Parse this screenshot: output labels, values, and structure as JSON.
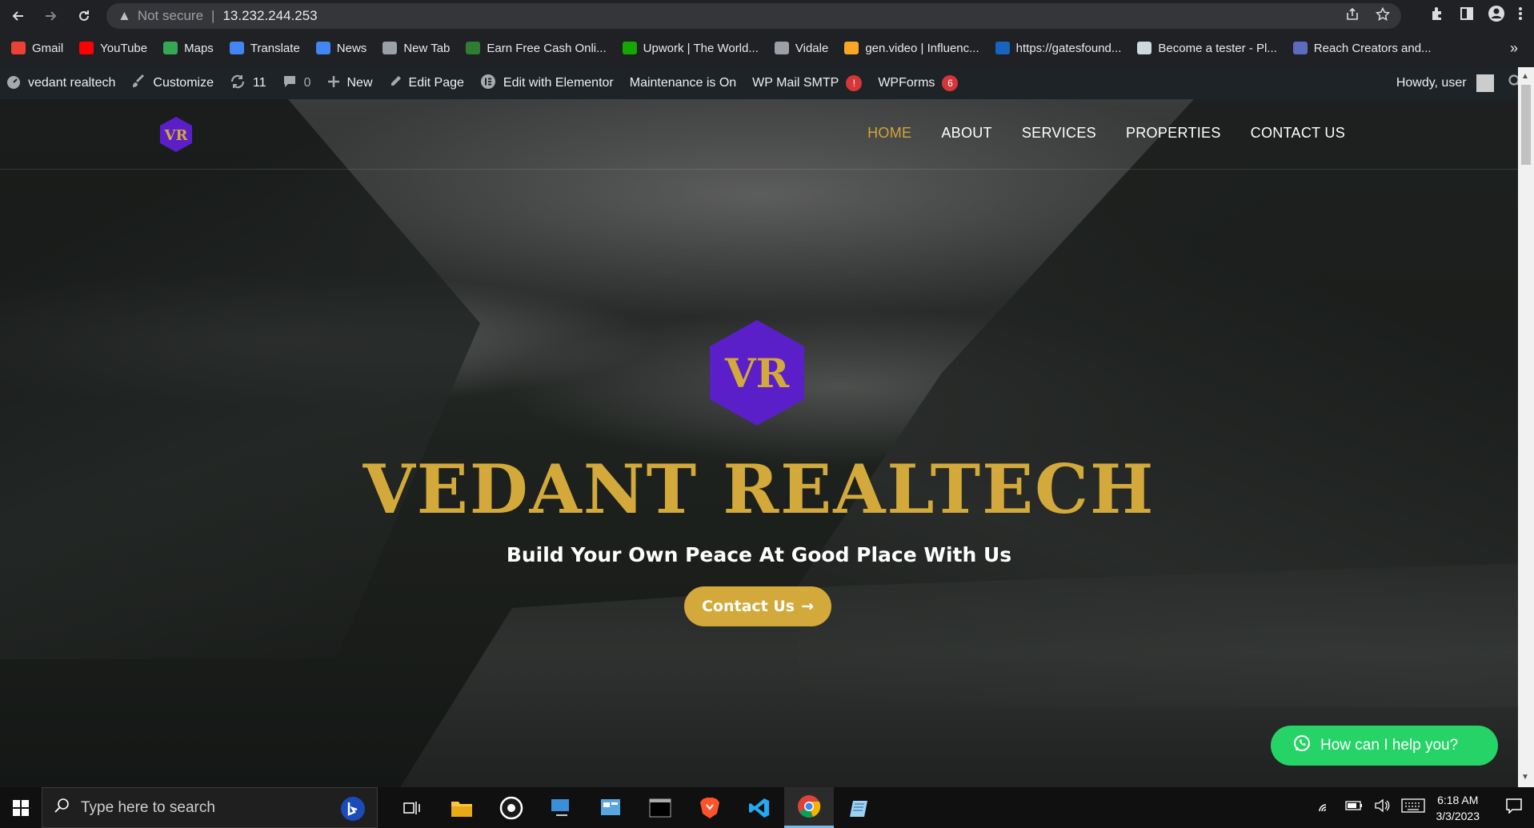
{
  "browser": {
    "address": "13.232.244.253",
    "security_label": "Not secure"
  },
  "bookmarks": [
    {
      "label": "Gmail",
      "color": "#ea4335"
    },
    {
      "label": "YouTube",
      "color": "#ff0000"
    },
    {
      "label": "Maps",
      "color": "#34a853"
    },
    {
      "label": "Translate",
      "color": "#4285f4"
    },
    {
      "label": "News",
      "color": "#4285f4"
    },
    {
      "label": "New Tab",
      "color": "#9aa0a6"
    },
    {
      "label": "Earn Free Cash Onli...",
      "color": "#2e7d32"
    },
    {
      "label": "Upwork | The World...",
      "color": "#14a800"
    },
    {
      "label": "Vidale",
      "color": "#9aa0a6"
    },
    {
      "label": "gen.video | Influenc...",
      "color": "#f9a825"
    },
    {
      "label": "https://gatesfound...",
      "color": "#1565c0"
    },
    {
      "label": "Become a tester - Pl...",
      "color": "#cfd8dc"
    },
    {
      "label": "Reach Creators and...",
      "color": "#5c6bc0"
    }
  ],
  "wpbar": {
    "site": "vedant realtech",
    "customize": "Customize",
    "updates": "11",
    "comments": "0",
    "new": "New",
    "edit_page": "Edit Page",
    "elementor": "Edit with Elementor",
    "maintenance": "Maintenance is On",
    "mail": "WP Mail SMTP",
    "mail_badge": "!",
    "wpforms": "WPForms",
    "wpforms_badge": "6",
    "howdy": "Howdy, user"
  },
  "site": {
    "logo_text": "VR",
    "nav": [
      "HOME",
      "ABOUT",
      "SERVICES",
      "PROPERTIES",
      "CONTACT US"
    ],
    "title": "VEDANT REALTECH",
    "tagline": "Build Your Own Peace At Good Place With Us",
    "cta": "Contact Us",
    "whatsapp": "How can I help you?",
    "accent": "#d2a93a",
    "logo_color": "#5b1fc9"
  },
  "taskbar": {
    "search_placeholder": "Type here to search",
    "time": "6:18 AM",
    "date": "3/3/2023"
  }
}
